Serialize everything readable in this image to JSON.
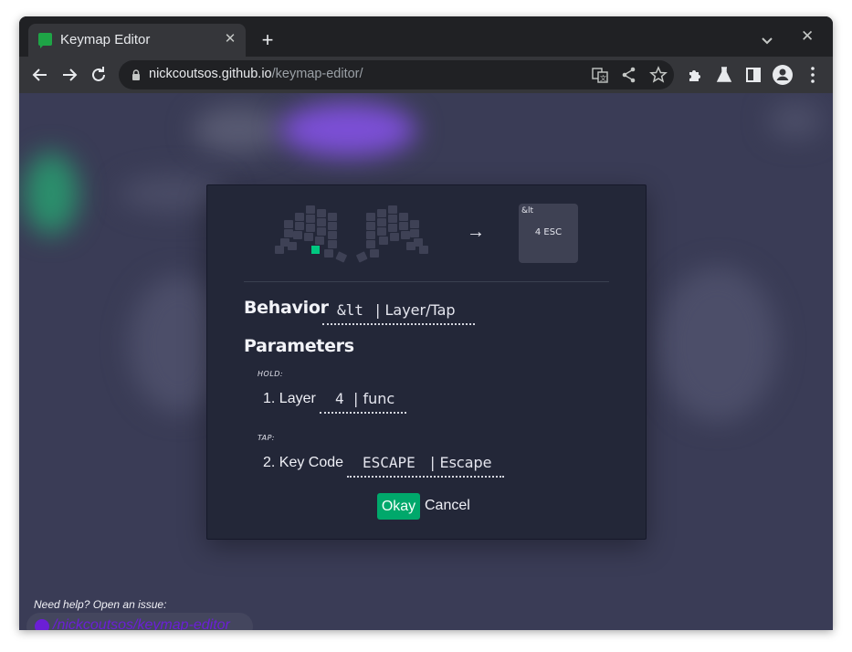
{
  "browser": {
    "tab_title": "Keymap Editor",
    "tab_close": "✕",
    "new_tab": "+",
    "window_close": "✕",
    "url_host": "nickcoutsos.github.io",
    "url_path": "/keymap-editor/"
  },
  "modal": {
    "arrow": "→",
    "key_preview": {
      "label": "&lt",
      "value": "4 ESC"
    },
    "behavior": {
      "label": "Behavior",
      "code": "&lt",
      "name": "| Layer/Tap"
    },
    "parameters_label": "Parameters",
    "hold": {
      "caption": "HOLD:",
      "label": "1. Layer",
      "code": "4",
      "name": "| func"
    },
    "tap": {
      "caption": "TAP:",
      "label": "2. Key Code",
      "code": "ESCAPE",
      "name": "| Escape"
    },
    "okay_label": "Okay",
    "cancel_label": "Cancel",
    "colors": {
      "accent": "#00a86b",
      "selected_key": "#00c780"
    }
  },
  "footer": {
    "help_text": "Need help? Open an issue:",
    "link_text": "/nickcoutsos/keymap-editor",
    "link_color": "#6b1fd6"
  }
}
